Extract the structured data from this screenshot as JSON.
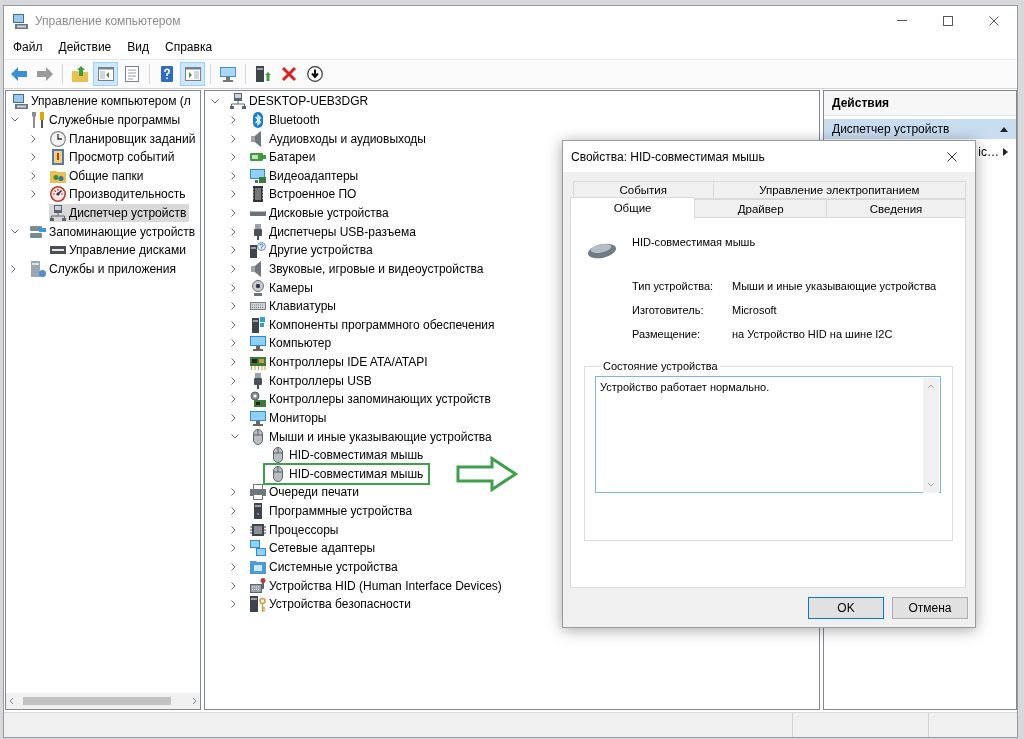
{
  "window": {
    "title": "Управление компьютером"
  },
  "menu": [
    "Файл",
    "Действие",
    "Вид",
    "Справка"
  ],
  "toolbar": {
    "groups": [
      [
        {
          "disabled": false,
          "pressed": false
        },
        {
          "disabled": true,
          "pressed": false
        }
      ],
      [
        {
          "disabled": false,
          "pressed": false
        },
        {
          "disabled": false,
          "pressed": true
        },
        {
          "disabled": false,
          "pressed": false
        }
      ],
      [
        {
          "disabled": false,
          "pressed": false
        },
        {
          "disabled": false,
          "pressed": true
        }
      ],
      [
        {
          "disabled": false,
          "pressed": false
        }
      ],
      [
        {
          "disabled": false,
          "pressed": false
        },
        {
          "disabled": false,
          "pressed": false
        },
        {
          "disabled": false,
          "pressed": false
        }
      ]
    ]
  },
  "console_tree": {
    "label": "Управление компьютером (л",
    "selected": false,
    "children": [
      {
        "label": "Служебные программы",
        "expanded": true,
        "selected": false,
        "children": [
          {
            "label": "Планировщик заданий",
            "expanded": false,
            "selected": false
          },
          {
            "label": "Просмотр событий",
            "expanded": false,
            "selected": false
          },
          {
            "label": "Общие папки",
            "expanded": false,
            "selected": false
          },
          {
            "label": "Производительность",
            "expanded": false,
            "selected": false
          },
          {
            "label": "Диспетчер устройств",
            "selected": true
          }
        ]
      },
      {
        "label": "Запоминающие устройств",
        "expanded": true,
        "selected": false,
        "children": [
          {
            "label": "Управление дисками",
            "selected": false
          }
        ]
      },
      {
        "label": "Службы и приложения",
        "expanded": false,
        "selected": false
      }
    ]
  },
  "device_tree": {
    "label": "DESKTOP-UEB3DGR",
    "expanded": true,
    "children": [
      {
        "label": "Bluetooth",
        "expanded": false
      },
      {
        "label": "Аудиовходы и аудиовыходы",
        "expanded": false
      },
      {
        "label": "Батареи",
        "expanded": false
      },
      {
        "label": "Видеоадаптеры",
        "expanded": false
      },
      {
        "label": "Встроенное ПО",
        "expanded": false
      },
      {
        "label": "Дисковые устройства",
        "expanded": false
      },
      {
        "label": "Диспетчеры USB-разъема",
        "expanded": false
      },
      {
        "label": "Другие устройства",
        "expanded": false
      },
      {
        "label": "Звуковые, игровые и видеоустройства",
        "expanded": false
      },
      {
        "label": "Камеры",
        "expanded": false
      },
      {
        "label": "Клавиатуры",
        "expanded": false
      },
      {
        "label": "Компоненты программного обеспечения",
        "expanded": false
      },
      {
        "label": "Компьютер",
        "expanded": false
      },
      {
        "label": "Контроллеры IDE ATA/ATAPI",
        "expanded": false
      },
      {
        "label": "Контроллеры USB",
        "expanded": false
      },
      {
        "label": "Контроллеры запоминающих устройств",
        "expanded": false
      },
      {
        "label": "Мониторы",
        "expanded": false
      },
      {
        "label": "Мыши и иные указывающие устройства",
        "expanded": true,
        "children": [
          {
            "label": "HID-совместимая мышь",
            "highlighted": false
          },
          {
            "label": "HID-совместимая мышь",
            "highlighted": true
          }
        ]
      },
      {
        "label": "Очереди печати",
        "expanded": false
      },
      {
        "label": "Программные устройства",
        "expanded": false
      },
      {
        "label": "Процессоры",
        "expanded": false
      },
      {
        "label": "Сетевые адаптеры",
        "expanded": false
      },
      {
        "label": "Системные устройства",
        "expanded": false
      },
      {
        "label": "Устройства HID (Human Interface Devices)",
        "expanded": false
      },
      {
        "label": "Устройства безопасности",
        "expanded": false
      }
    ]
  },
  "actions": {
    "title": "Действия",
    "section": {
      "label": "Диспетчер устройств",
      "expanded": true,
      "items": [
        {
          "label": "ic…"
        }
      ]
    }
  },
  "dialog": {
    "title": "Свойства: HID-совместимая мышь",
    "tab_rows": [
      [
        {
          "label": "События",
          "selected": false
        },
        {
          "label": "Управление электропитанием",
          "selected": false
        }
      ],
      [
        {
          "label": "Общие",
          "selected": true
        },
        {
          "label": "Драйвер",
          "selected": false
        },
        {
          "label": "Сведения",
          "selected": false
        }
      ]
    ],
    "device_name": "HID-совместимая мышь",
    "properties": [
      {
        "label": "Тип устройства:",
        "value": "Мыши и иные указывающие устройства"
      },
      {
        "label": "Изготовитель:",
        "value": "Microsoft"
      },
      {
        "label": "Размещение:",
        "value": "на Устройство HID на шине I2C"
      }
    ],
    "status_group": {
      "title": "Состояние устройства",
      "text": "Устройство работает нормально."
    },
    "buttons": [
      {
        "label": "OK",
        "default": true
      },
      {
        "label": "Отмена",
        "default": false
      }
    ]
  }
}
